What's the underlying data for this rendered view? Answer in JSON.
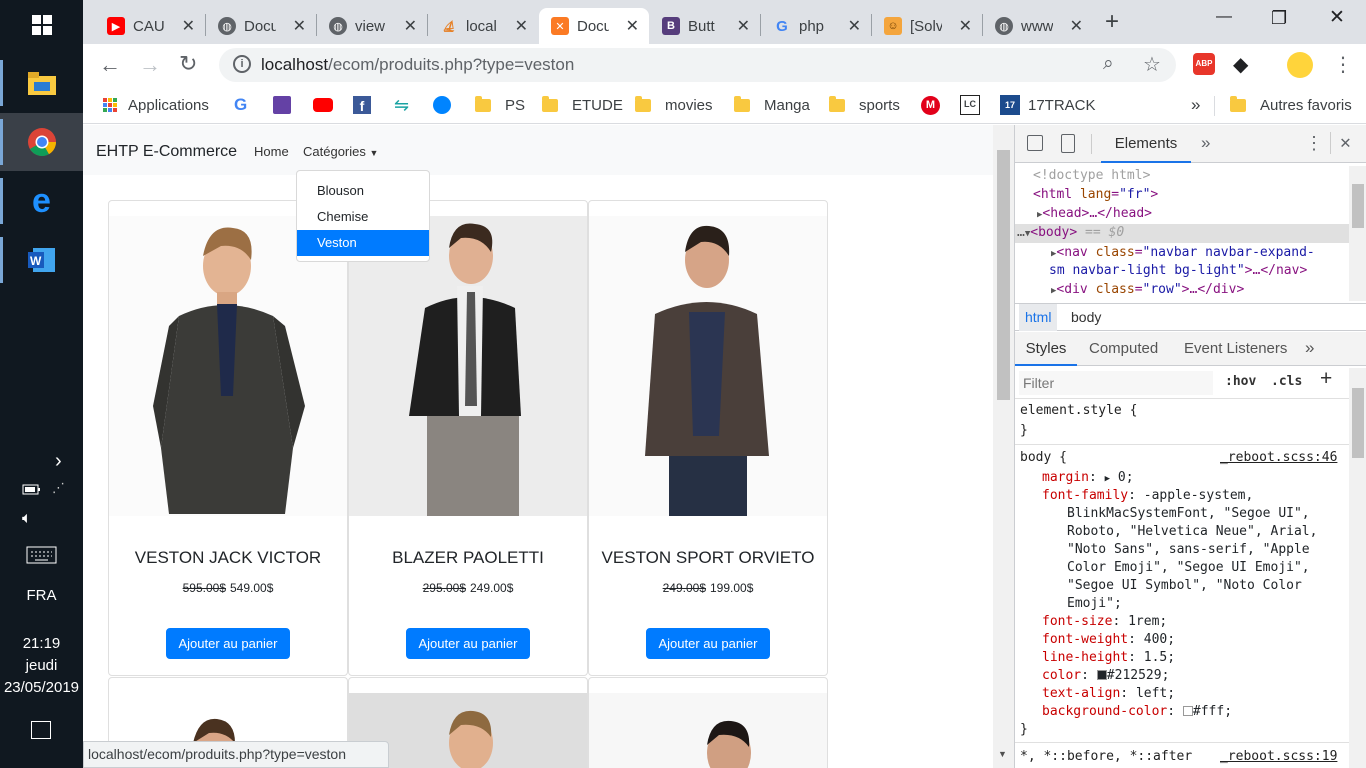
{
  "taskbar": {
    "lang": "FRA",
    "time": "21:19",
    "day": "jeudi",
    "date": "23/05/2019"
  },
  "tabs": [
    {
      "title": "CAU",
      "close": "✕"
    },
    {
      "title": "Docu",
      "close": "✕"
    },
    {
      "title": "view",
      "close": "✕"
    },
    {
      "title": "local",
      "close": "✕"
    },
    {
      "title": "Docu",
      "close": "✕"
    },
    {
      "title": "Butt",
      "close": "✕"
    },
    {
      "title": "php",
      "close": "✕"
    },
    {
      "title": "[Solv",
      "close": "✕"
    },
    {
      "title": "www",
      "close": "✕"
    }
  ],
  "new_tab": "+",
  "window": {
    "minimize": "—",
    "maximize": "❐",
    "close": "✕"
  },
  "omnibox": {
    "host": "localhost",
    "path": "/ecom/produits.php?type=veston"
  },
  "bookmarks": {
    "apps": "Applications",
    "items": [
      "PS",
      "ETUDE",
      "movies",
      "Manga",
      "sports"
    ],
    "track": "17TRACK",
    "more": "»",
    "other": "Autres favoris"
  },
  "navbar": {
    "brand": "EHTP E-Commerce",
    "home": "Home",
    "categories": "Catégories"
  },
  "dropdown": {
    "items": [
      "Blouson",
      "Chemise",
      "Veston"
    ],
    "active_index": 2
  },
  "products": [
    {
      "name": "VESTON JACK VICTOR",
      "old_price": "595.00$",
      "price": "549.00$",
      "button": "Ajouter au panier"
    },
    {
      "name": "BLAZER PAOLETTI",
      "old_price": "295.00$",
      "price": "249.00$",
      "button": "Ajouter au panier"
    },
    {
      "name": "VESTON SPORT ORVIETO",
      "old_price": "249.00$",
      "price": "199.00$",
      "button": "Ajouter au panier"
    }
  ],
  "status_url": "localhost/ecom/produits.php?type=veston",
  "devtools": {
    "tab_elements": "Elements",
    "more": "»",
    "breadcrumb": [
      "html",
      "body"
    ],
    "subtabs": [
      "Styles",
      "Computed",
      "Event Listeners"
    ],
    "filter_placeholder": "Filter",
    "hov": ":hov",
    "cls": ".cls",
    "add": "+",
    "dom": {
      "doctype": "<!doctype html>",
      "html_open": "<html ",
      "lang_attr": "lang",
      "lang_val": "\"fr\"",
      "html_close": ">",
      "head": "<head>…</head>",
      "body_prefix": "…",
      "body": "<body>",
      "body_eq": " == $0",
      "nav_open": "<nav ",
      "class_attr": "class",
      "nav_class_1": "\"navbar navbar-expand-",
      "nav_class_2": "sm navbar-light bg-light\"",
      "nav_end": ">…</nav>",
      "div_open": "<div ",
      "div_class": "\"row\"",
      "div_end": ">…</div>"
    },
    "css": {
      "element_style": "element.style {",
      "close_brace": "}",
      "body_sel": "body {",
      "source": "_reboot.scss:46",
      "margin": "margin",
      "margin_val": "0;",
      "font_family": "font-family",
      "font_family_val": [
        "-apple-system,",
        "BlinkMacSystemFont, \"Segoe UI\",",
        "Roboto, \"Helvetica Neue\", Arial,",
        "\"Noto Sans\", sans-serif, \"Apple",
        "Color Emoji\", \"Segoe UI Emoji\",",
        "\"Segoe UI Symbol\", \"Noto Color",
        "Emoji\";"
      ],
      "font_size": "font-size",
      "font_size_val": "1rem;",
      "font_weight": "font-weight",
      "font_weight_val": "400;",
      "line_height": "line-height",
      "line_height_val": "1.5;",
      "color": "color",
      "color_val": "#212529;",
      "text_align": "text-align",
      "text_align_val": "left;",
      "bg_color": "background-color",
      "bg_color_val": "#fff;",
      "next_sel": "*, *::before, *::after",
      "next_source": "_reboot.scss:19"
    }
  }
}
